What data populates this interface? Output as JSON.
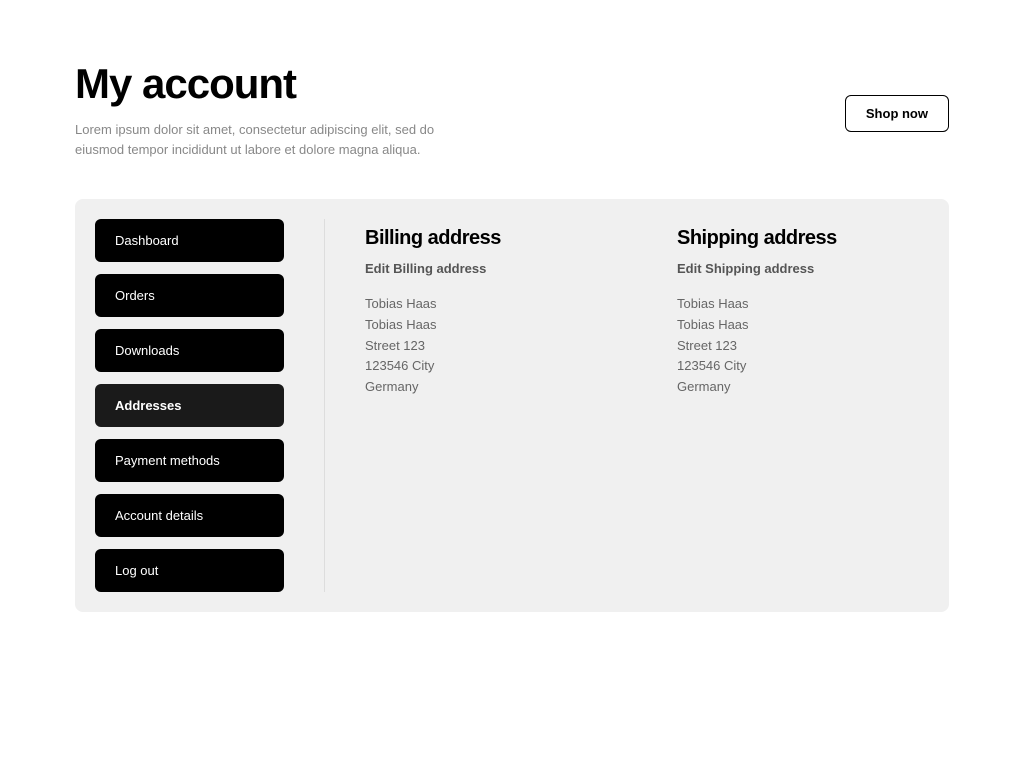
{
  "header": {
    "title": "My account",
    "description": "Lorem ipsum dolor sit amet, consectetur adipiscing elit, sed do eiusmod tempor incididunt ut labore et dolore magna aliqua.",
    "shop_now": "Shop now"
  },
  "sidebar": {
    "items": [
      {
        "label": "Dashboard",
        "active": false
      },
      {
        "label": "Orders",
        "active": false
      },
      {
        "label": "Downloads",
        "active": false
      },
      {
        "label": "Addresses",
        "active": true
      },
      {
        "label": "Payment methods",
        "active": false
      },
      {
        "label": "Account details",
        "active": false
      },
      {
        "label": "Log out",
        "active": false
      }
    ]
  },
  "billing": {
    "heading": "Billing address",
    "edit_label": "Edit Billing address",
    "lines": [
      "Tobias Haas",
      "Tobias Haas",
      "Street 123",
      "123546 City",
      "Germany"
    ]
  },
  "shipping": {
    "heading": "Shipping address",
    "edit_label": "Edit Shipping address",
    "lines": [
      "Tobias Haas",
      "Tobias Haas",
      "Street 123",
      "123546 City",
      "Germany"
    ]
  }
}
